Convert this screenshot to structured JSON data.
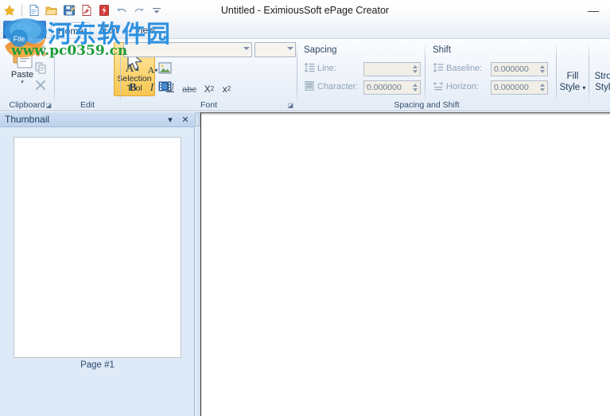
{
  "window": {
    "title": "Untitled - EximiousSoft ePage Creator",
    "minimize_glyph": "—"
  },
  "quick_access": {
    "items": [
      {
        "name": "new-document-icon",
        "label": "New"
      },
      {
        "name": "open-folder-icon",
        "label": "Open"
      },
      {
        "name": "save-icon",
        "label": "Save"
      },
      {
        "name": "export-pdf-icon",
        "label": "Export PDF"
      },
      {
        "name": "export-flash-icon",
        "label": "Export Flash"
      },
      {
        "name": "undo-icon",
        "label": "Undo"
      },
      {
        "name": "redo-icon",
        "label": "Redo"
      },
      {
        "name": "customize-qat-icon",
        "label": "Customize Quick Access Toolbar"
      }
    ]
  },
  "ribbon": {
    "file_tab": "File",
    "tabs": [
      {
        "label": "Home",
        "active": true
      },
      {
        "label": "Edit",
        "active": false
      },
      {
        "label": "View",
        "active": false
      }
    ],
    "groups": {
      "clipboard": {
        "label": "Clipboard",
        "paste_label": "Paste",
        "cut_label": "Cut",
        "copy_label": "Copy",
        "delete_label": "Delete",
        "launcher_glyph": "◪"
      },
      "edit": {
        "label": "Edit",
        "selection_tool_line1": "Selection",
        "selection_tool_line2": "Tool",
        "text_tool_label": "Text",
        "image_tool_label": "Image",
        "media_tool_label": "Media"
      },
      "font": {
        "label": "Font",
        "font_name_value": "",
        "font_size_value": "",
        "grow_font_label": "A",
        "shrink_font_label": "A",
        "bold_label": "B",
        "italic_label": "I",
        "underline_label": "U",
        "strike_label": "abc",
        "subscript_label": "X",
        "subscript_sup": "2",
        "superscript_label": "x",
        "superscript_sup": "2",
        "launcher_glyph": "◪"
      },
      "spacing_and_shift": {
        "label": "Spacing and Shift",
        "spacing_header": "Sapcing",
        "shift_header": "Shift",
        "line_label": "Line:",
        "line_value": "",
        "character_label": "Character:",
        "character_value": "0.000000",
        "baseline_label": "Baseline:",
        "baseline_value": "0.000000",
        "horizon_label": "Horizon:",
        "horizon_value": "0.000000"
      },
      "fill_style": {
        "line1": "Fill",
        "line2": "Style",
        "caret": "▾"
      },
      "stroke_style": {
        "line1": "Strok",
        "line2": "Style"
      }
    }
  },
  "thumbnail_panel": {
    "title": "Thumbnail",
    "dropdown_glyph": "▾",
    "close_glyph": "✕",
    "page_label": "Page #1"
  },
  "canvas": {
    "background": "#ffffff"
  },
  "watermark": {
    "text_cn": "河东软件园",
    "text_url": "www.pc0359.cn",
    "color_cn": "#2f92e0",
    "color_url": "#1f9e3a"
  },
  "colors": {
    "ribbon_bg": "#eef3fa",
    "panel_bg": "#dfeaf8",
    "accent_selected": "#f7c64f",
    "file_tab_blue": "#1f63b5",
    "label_disabled": "#8fa3b8"
  }
}
